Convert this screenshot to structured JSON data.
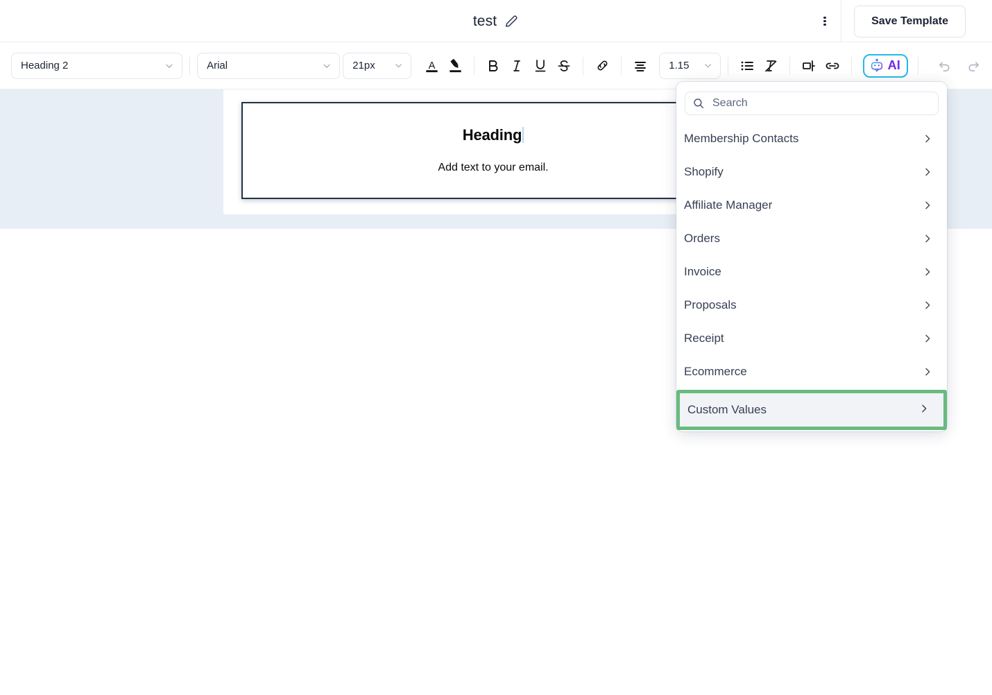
{
  "header": {
    "doc_title": "test",
    "edit_icon": "pencil-icon",
    "kebab_icon": "more-vertical-icon",
    "save_label": "Save Template"
  },
  "toolbar": {
    "paragraph_style": "Heading 2",
    "font_family": "Arial",
    "font_size": "21px",
    "line_height": "1.15",
    "buttons": [
      {
        "name": "text-color-icon",
        "label": "A"
      },
      {
        "name": "highlight-color-icon",
        "label": ""
      },
      {
        "name": "bold-icon",
        "label": "B"
      },
      {
        "name": "italic-icon",
        "label": "I"
      },
      {
        "name": "underline-icon",
        "label": "U"
      },
      {
        "name": "strikethrough-icon",
        "label": "S"
      },
      {
        "name": "link-icon",
        "label": ""
      },
      {
        "name": "align-icon",
        "label": ""
      },
      {
        "name": "bullet-list-icon",
        "label": ""
      },
      {
        "name": "clear-formatting-icon",
        "label": ""
      },
      {
        "name": "split-block-icon",
        "label": ""
      },
      {
        "name": "merge-link-icon",
        "label": ""
      }
    ],
    "ai_label": "AI",
    "undo_label": "Undo",
    "redo_label": "Redo"
  },
  "canvas": {
    "heading": "Heading",
    "subtext": "Add text to your email."
  },
  "menu": {
    "search_placeholder": "Search",
    "search_value": "",
    "items": [
      {
        "label": "Membership Contacts",
        "highlighted": false
      },
      {
        "label": "Shopify",
        "highlighted": false
      },
      {
        "label": "Affiliate Manager",
        "highlighted": false
      },
      {
        "label": "Orders",
        "highlighted": false
      },
      {
        "label": "Invoice",
        "highlighted": false
      },
      {
        "label": "Proposals",
        "highlighted": false
      },
      {
        "label": "Receipt",
        "highlighted": false
      },
      {
        "label": "Ecommerce",
        "highlighted": false
      },
      {
        "label": "Custom Values",
        "highlighted": true
      }
    ]
  },
  "colors": {
    "canvas_bg": "#e8eef5",
    "highlight_green": "#68bb7e",
    "ai_border": "#22b9ea",
    "ai_text": "#7330e6",
    "block_border": "#22304a"
  }
}
